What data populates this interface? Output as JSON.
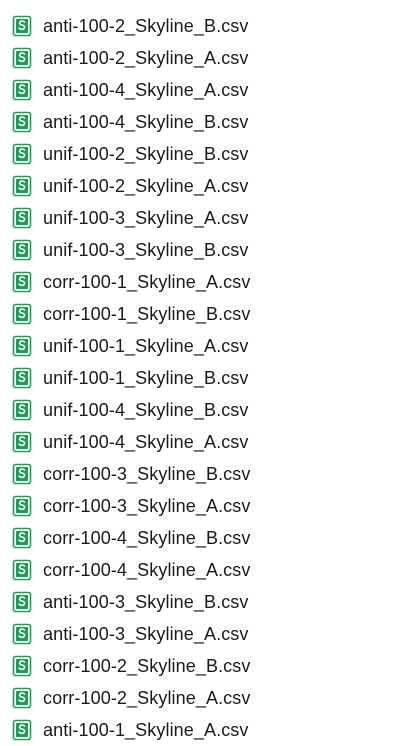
{
  "files": [
    {
      "name": "anti-100-2_Skyline_B.csv",
      "icon": "spreadsheet-csv-icon"
    },
    {
      "name": "anti-100-2_Skyline_A.csv",
      "icon": "spreadsheet-csv-icon"
    },
    {
      "name": "anti-100-4_Skyline_A.csv",
      "icon": "spreadsheet-csv-icon"
    },
    {
      "name": "anti-100-4_Skyline_B.csv",
      "icon": "spreadsheet-csv-icon"
    },
    {
      "name": "unif-100-2_Skyline_B.csv",
      "icon": "spreadsheet-csv-icon"
    },
    {
      "name": "unif-100-2_Skyline_A.csv",
      "icon": "spreadsheet-csv-icon"
    },
    {
      "name": "unif-100-3_Skyline_A.csv",
      "icon": "spreadsheet-csv-icon"
    },
    {
      "name": "unif-100-3_Skyline_B.csv",
      "icon": "spreadsheet-csv-icon"
    },
    {
      "name": "corr-100-1_Skyline_A.csv",
      "icon": "spreadsheet-csv-icon"
    },
    {
      "name": "corr-100-1_Skyline_B.csv",
      "icon": "spreadsheet-csv-icon"
    },
    {
      "name": "unif-100-1_Skyline_A.csv",
      "icon": "spreadsheet-csv-icon"
    },
    {
      "name": "unif-100-1_Skyline_B.csv",
      "icon": "spreadsheet-csv-icon"
    },
    {
      "name": "unif-100-4_Skyline_B.csv",
      "icon": "spreadsheet-csv-icon"
    },
    {
      "name": "unif-100-4_Skyline_A.csv",
      "icon": "spreadsheet-csv-icon"
    },
    {
      "name": "corr-100-3_Skyline_B.csv",
      "icon": "spreadsheet-csv-icon"
    },
    {
      "name": "corr-100-3_Skyline_A.csv",
      "icon": "spreadsheet-csv-icon"
    },
    {
      "name": "corr-100-4_Skyline_B.csv",
      "icon": "spreadsheet-csv-icon"
    },
    {
      "name": "corr-100-4_Skyline_A.csv",
      "icon": "spreadsheet-csv-icon"
    },
    {
      "name": "anti-100-3_Skyline_B.csv",
      "icon": "spreadsheet-csv-icon"
    },
    {
      "name": "anti-100-3_Skyline_A.csv",
      "icon": "spreadsheet-csv-icon"
    },
    {
      "name": "corr-100-2_Skyline_B.csv",
      "icon": "spreadsheet-csv-icon"
    },
    {
      "name": "corr-100-2_Skyline_A.csv",
      "icon": "spreadsheet-csv-icon"
    },
    {
      "name": "anti-100-1_Skyline_A.csv",
      "icon": "spreadsheet-csv-icon"
    }
  ],
  "colors": {
    "icon_green": "#1e9b5a",
    "icon_border": "#1e9b5a",
    "text": "#1a1a1a",
    "background": "#ffffff"
  }
}
